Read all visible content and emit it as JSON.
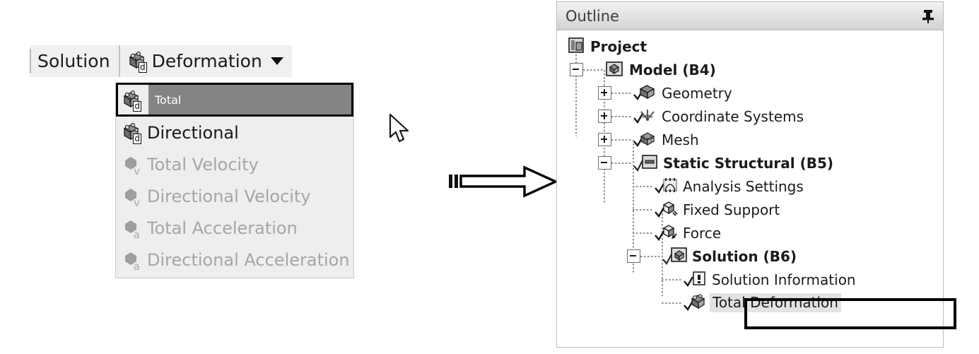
{
  "toolbar": {
    "solution_label": "Solution",
    "deformation_button_label": "Deformation",
    "dropdown_caret_icon": "chevron-down-icon",
    "deformation_icon": "deformation-cube-icon"
  },
  "dropdown_menu": {
    "items": [
      {
        "label": "Total",
        "icon": "deformation-cube-icon",
        "subscript": "d",
        "enabled": true,
        "selected": true
      },
      {
        "label": "Directional",
        "icon": "deformation-cube-icon",
        "subscript": "d",
        "enabled": true,
        "selected": false
      },
      {
        "label": "Total Velocity",
        "icon": "velocity-hex-icon",
        "subscript": "v",
        "enabled": false,
        "selected": false
      },
      {
        "label": "Directional Velocity",
        "icon": "velocity-hex-icon",
        "subscript": "v",
        "enabled": false,
        "selected": false
      },
      {
        "label": "Total Acceleration",
        "icon": "acceleration-hex-icon",
        "subscript": "a",
        "enabled": false,
        "selected": false
      },
      {
        "label": "Directional Acceleration",
        "icon": "acceleration-hex-icon",
        "subscript": "a",
        "enabled": false,
        "selected": false
      }
    ]
  },
  "annotation": {
    "flow_arrow_icon": "right-block-arrow-icon",
    "cursor_icon": "mouse-pointer-icon"
  },
  "outline_panel": {
    "title": "Outline",
    "pin_icon": "pin-icon",
    "tree": [
      {
        "label": "Project",
        "depth": 0,
        "toggle": "none",
        "icon": "project-folder-icon",
        "bold": true,
        "check": false,
        "selected": false
      },
      {
        "label": "Model (B4)",
        "depth": 1,
        "toggle": "minus",
        "icon": "model-folder-icon",
        "bold": true,
        "check": false,
        "selected": false
      },
      {
        "label": "Geometry",
        "depth": 2,
        "toggle": "plus",
        "icon": "geometry-icon",
        "bold": false,
        "check": true,
        "selected": false
      },
      {
        "label": "Coordinate Systems",
        "depth": 2,
        "toggle": "plus",
        "icon": "coordinate-systems-icon",
        "bold": false,
        "check": true,
        "selected": false
      },
      {
        "label": "Mesh",
        "depth": 2,
        "toggle": "plus",
        "icon": "mesh-icon",
        "bold": false,
        "check": true,
        "selected": false
      },
      {
        "label": "Static Structural (B5)",
        "depth": 2,
        "toggle": "minus",
        "icon": "analysis-folder-icon",
        "bold": true,
        "check": true,
        "selected": false
      },
      {
        "label": "Analysis Settings",
        "depth": 3,
        "toggle": "none",
        "icon": "analysis-settings-icon",
        "bold": false,
        "check": true,
        "selected": false
      },
      {
        "label": "Fixed Support",
        "depth": 3,
        "toggle": "none",
        "icon": "fixed-support-icon",
        "bold": false,
        "check": true,
        "selected": false
      },
      {
        "label": "Force",
        "depth": 3,
        "toggle": "none",
        "icon": "force-icon",
        "bold": false,
        "check": true,
        "selected": false
      },
      {
        "label": "Solution (B6)",
        "depth": 3,
        "toggle": "minus",
        "icon": "solution-folder-icon",
        "bold": true,
        "check": true,
        "selected": false
      },
      {
        "label": "Solution Information",
        "depth": 4,
        "toggle": "none",
        "icon": "solution-information-icon",
        "bold": false,
        "check": true,
        "selected": false
      },
      {
        "label": "Total Deformation",
        "depth": 4,
        "toggle": "none",
        "icon": "deformation-result-icon",
        "bold": false,
        "check": true,
        "selected": true
      }
    ]
  },
  "colors": {
    "selection_gray": "#848484",
    "tree_selection": "#e2e2e2",
    "toolbar_bg": "#f0f0f0",
    "menu_bg": "#eeeeee",
    "disabled_text": "#a6a6a6",
    "annotation_black": "#000000"
  }
}
